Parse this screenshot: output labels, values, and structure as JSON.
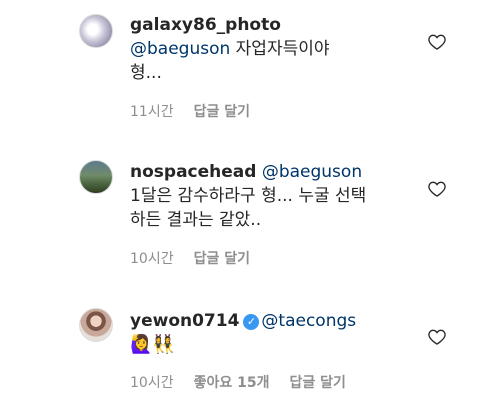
{
  "comments": [
    {
      "username": "galaxy86_photo",
      "mention": "@baeguson",
      "text_line1": " 자업자득이야",
      "text_line2": "형...",
      "time": "11시간",
      "likes": "",
      "reply_label": "답글 달기",
      "avatar_icon": "avatar-white-flower"
    },
    {
      "username": "nospacehead",
      "mention": "@baeguson",
      "text_line1": "1달은 감수하라구 형... 누굴 선택",
      "text_line2": "하든 결과는 같았..",
      "time": "10시간",
      "likes": "",
      "reply_label": "답글 달기",
      "avatar_icon": "avatar-field-landscape"
    },
    {
      "username": "yewon0714",
      "verified": true,
      "mention": "@taecongs",
      "emojis": "🙋‍♀️👯‍♀️",
      "time": "10시간",
      "likes": "좋아요 15개",
      "reply_label": "답글 달기",
      "avatar_icon": "avatar-person"
    }
  ]
}
